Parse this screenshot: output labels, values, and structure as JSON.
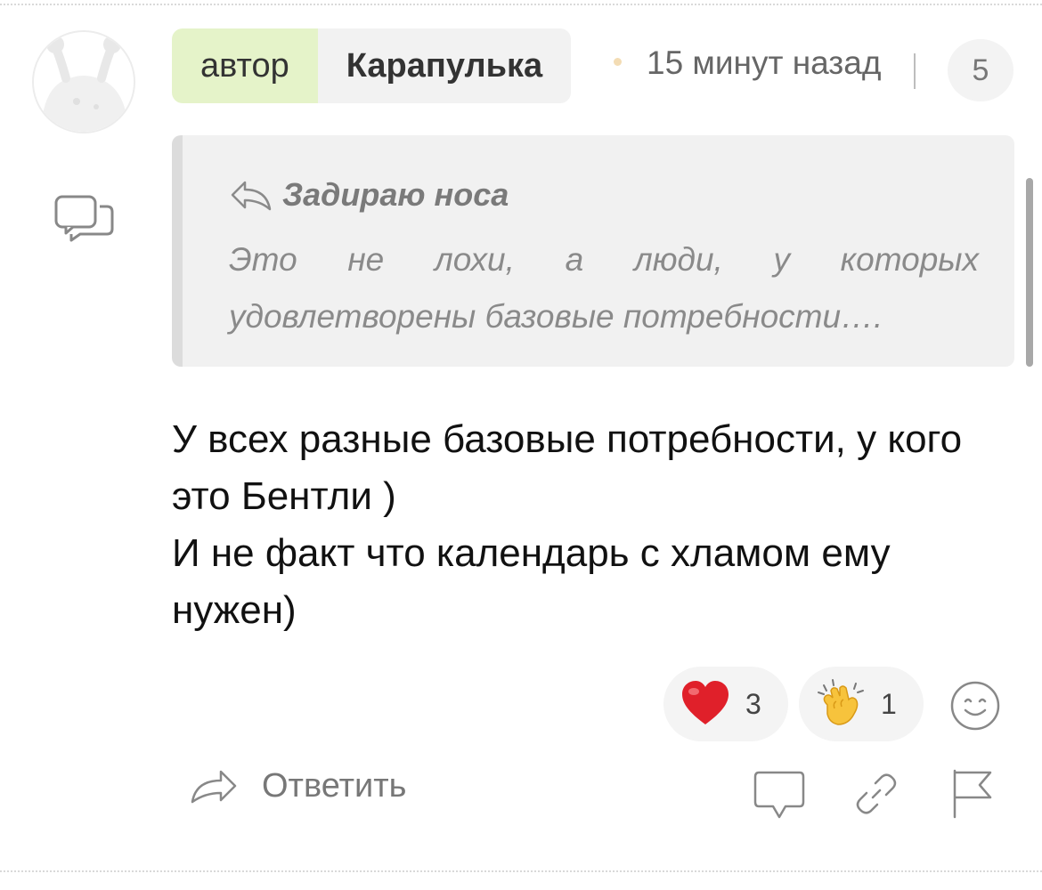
{
  "comment": {
    "author_tag": "автор",
    "author_name": "Карапулька",
    "timestamp": "15 минут назад",
    "count_badge": "5",
    "avatar_icon": "snail-avatar-icon",
    "quote": {
      "author": "Задираю носа",
      "text": "Это не лохи, а люди, у которых удовлетворены базовые потребности…."
    },
    "body": "У всех разные базовые потребности, у кого это Бентли )\nИ не факт что календарь с хламом ему нужен)"
  },
  "reactions": [
    {
      "icon": "heart-icon",
      "count": "3"
    },
    {
      "icon": "clap-icon",
      "count": "1"
    }
  ],
  "actions": {
    "reply_label": "Ответить",
    "icons": [
      "reply-arrow-icon",
      "comment-icon",
      "link-icon",
      "flag-icon",
      "smiley-icon"
    ]
  },
  "colors": {
    "author_tag_bg": "#e5f3c9",
    "chip_bg": "#f2f2f2",
    "quote_bg": "#f1f1f1",
    "dot": "#f3dcb4"
  }
}
